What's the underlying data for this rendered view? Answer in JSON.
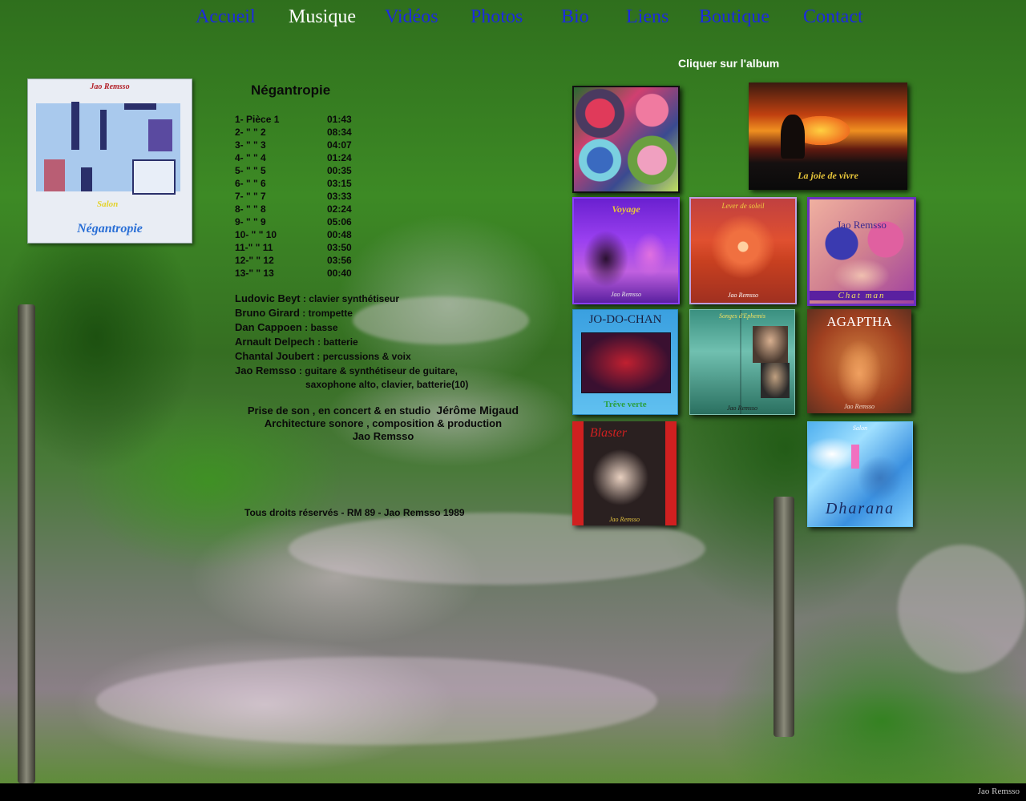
{
  "nav": {
    "items": [
      {
        "label": "Accueil",
        "active": false
      },
      {
        "label": "Musique",
        "active": true
      },
      {
        "label": "Vidéos",
        "active": false
      },
      {
        "label": "Photos",
        "active": false
      },
      {
        "label": "Bio",
        "active": false
      },
      {
        "label": "Liens",
        "active": false
      },
      {
        "label": "Boutique",
        "active": false
      },
      {
        "label": "Contact",
        "active": false
      }
    ]
  },
  "cover": {
    "artist": "Jao Remsso",
    "subtitle": "Salon",
    "title": "Négantropie"
  },
  "album": {
    "title": "Négantropie",
    "tracks": [
      {
        "num": "1- Pièce 1",
        "dur": "01:43"
      },
      {
        "num": "2- \"    \"    2",
        "dur": "08:34"
      },
      {
        "num": "3- \"    \"    3",
        "dur": "04:07"
      },
      {
        "num": "4- \"    \"    4",
        "dur": "01:24"
      },
      {
        "num": "5- \"    \"    5",
        "dur": "00:35"
      },
      {
        "num": "6- \"    \"    6",
        "dur": "03:15"
      },
      {
        "num": "7- \"    \"    7",
        "dur": "03:33"
      },
      {
        "num": "8- \"    \"    8",
        "dur": "02:24"
      },
      {
        "num": "9- \"    \"    9",
        "dur": "05:06"
      },
      {
        "num": "10- \"   \"  10",
        "dur": "00:48"
      },
      {
        "num": "11-\"    \"  11",
        "dur": "03:50"
      },
      {
        "num": "12-\"    \"  12",
        "dur": "03:56"
      },
      {
        "num": "13-\"    \"  13",
        "dur": "00:40"
      }
    ],
    "musicians": [
      {
        "name": "Ludovic Beyt",
        "role": " : clavier synthétiseur"
      },
      {
        "name": "Bruno Girard",
        "role": " : trompette"
      },
      {
        "name": "Dan Cappoen",
        "role": " : basse"
      },
      {
        "name": "Arnault Delpech",
        "role": " : batterie"
      },
      {
        "name": "Chantal Joubert",
        "role": " : percussions & voix"
      },
      {
        "name": "Jao Remsso",
        "role": " : guitare & synthétiseur de guitare,"
      }
    ],
    "musicians_cont": "saxophone alto, clavier, batterie(10)",
    "production": {
      "line1_prefix": "Prise de son , en concert & en studio",
      "line1_name": "Jérôme Migaud",
      "line2": "Architecture sonore , composition & production",
      "line3": "Jao Remsso"
    },
    "copyright": "Tous droits réservés - RM 89 - Jao Remsso 1989"
  },
  "grid": {
    "hint": "Cliquer sur l'album",
    "albums": [
      {
        "id": "flowers",
        "caption": ""
      },
      {
        "id": "joie",
        "caption": "La joie de vivre"
      },
      {
        "id": "voyage",
        "caption": "Voyage",
        "sub": "Jao Remsso"
      },
      {
        "id": "soleil",
        "caption": "Lever de soleil",
        "sub": "Jao Remsso"
      },
      {
        "id": "chatman",
        "caption": "Chat man",
        "sub": "Jao Remsso"
      },
      {
        "id": "jodochan",
        "caption": "JO-DO-CHAN",
        "sub": "Trêve verte"
      },
      {
        "id": "songes",
        "caption": "Songes d'Ephemis",
        "sub": "Jao Remsso"
      },
      {
        "id": "agaptha",
        "caption": "AGAPTHA",
        "sub": "Jao Remsso"
      },
      {
        "id": "blaster",
        "caption": "Blaster",
        "sub": "Jao Remsso"
      },
      {
        "id": "dharana",
        "caption": "Dharana",
        "sub": "Salon"
      }
    ]
  },
  "footer": {
    "credit": "Jao Remsso"
  }
}
